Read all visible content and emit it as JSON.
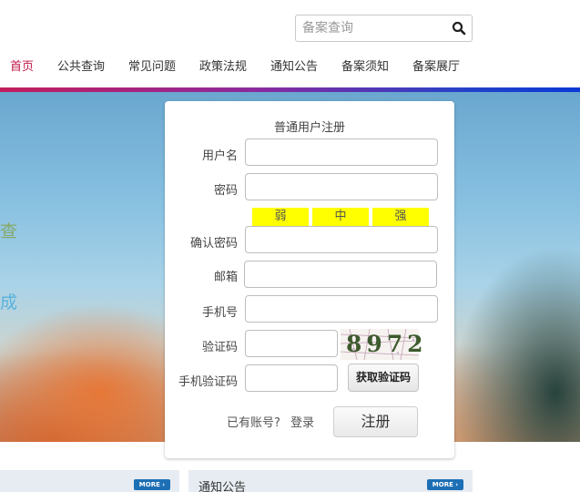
{
  "search": {
    "placeholder": "备案查询",
    "icon": "search-icon"
  },
  "nav": {
    "items": [
      {
        "label": "首页",
        "active": true
      },
      {
        "label": "公共查询"
      },
      {
        "label": "常见问题"
      },
      {
        "label": "政策法规"
      },
      {
        "label": "通知公告"
      },
      {
        "label": "备案须知"
      },
      {
        "label": "备案展厅"
      }
    ],
    "active_color": "#c0174a"
  },
  "banner": {
    "text1": "查",
    "text2": "成"
  },
  "form": {
    "title": "普通用户注册",
    "username_label": "用户名",
    "password_label": "密码",
    "strength": [
      "弱",
      "中",
      "强"
    ],
    "strength_color": "#ffff00",
    "confirm_label": "确认密码",
    "email_label": "邮箱",
    "phone_label": "手机号",
    "captcha_label": "验证码",
    "captcha_text": "8972",
    "sms_label": "手机验证码",
    "sms_button": "获取验证码",
    "has_account": "已有账号?",
    "login_link": "登录",
    "register_button": "注册"
  },
  "bottom": {
    "right_title": "通知公告",
    "more_label": "MORE",
    "more_color": "#1d6fb5"
  }
}
